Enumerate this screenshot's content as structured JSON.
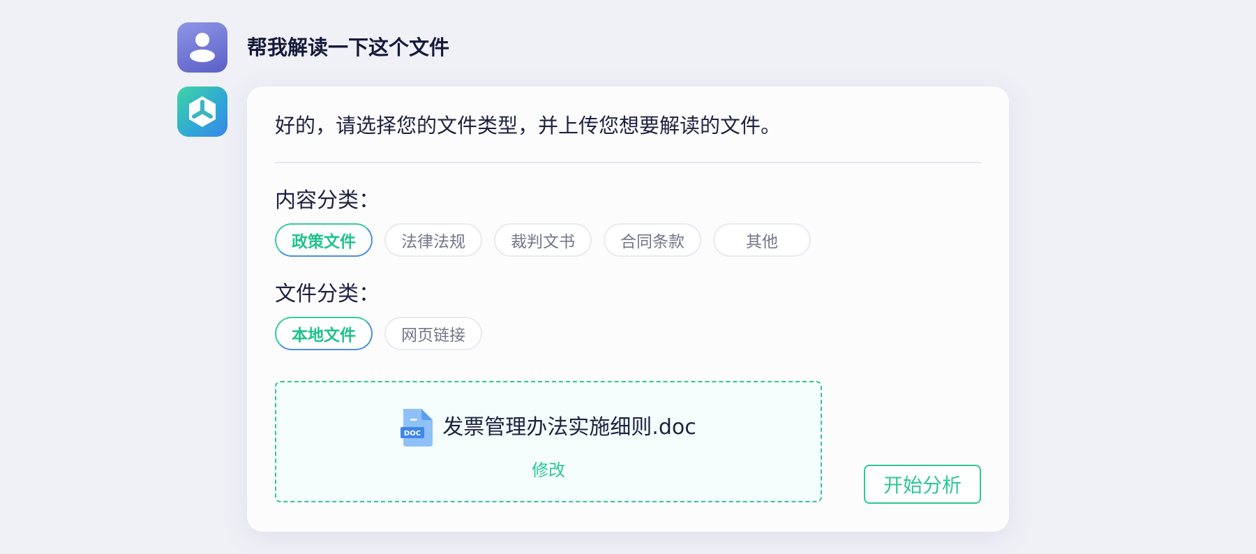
{
  "user": {
    "avatar_icon": "user-avatar-icon",
    "message": "帮我解读一下这个文件"
  },
  "bot": {
    "avatar_icon": "bot-logo-icon",
    "message": "好的，请选择您的文件类型，并上传您想要解读的文件。"
  },
  "content_category": {
    "label": "内容分类：",
    "options": [
      "政策文件",
      "法律法规",
      "裁判文书",
      "合同条款",
      "其他"
    ],
    "selected": "政策文件"
  },
  "file_category": {
    "label": "文件分类：",
    "options": [
      "本地文件",
      "网页链接"
    ],
    "selected": "本地文件"
  },
  "upload": {
    "file_icon": "doc-file-icon",
    "file_badge": "DOC",
    "file_name": "发票管理办法实施细则.doc",
    "modify_label": "修改"
  },
  "actions": {
    "start_label": "开始分析"
  },
  "colors": {
    "accent_green": "#2ec696",
    "accent_blue": "#4a90e2",
    "user_avatar": "#6b70d6"
  }
}
